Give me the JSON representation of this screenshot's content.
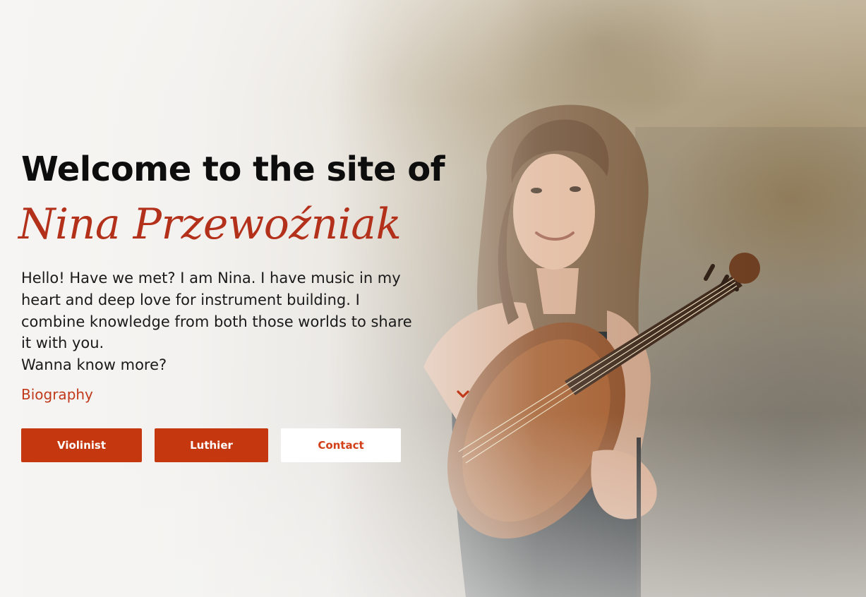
{
  "hero": {
    "welcome": "Welcome to the site of",
    "name": "Nina Przewoźniak",
    "intro_lines": [
      "Hello! Have we met? I am Nina. I have music in my heart and deep love for instrument building. I combine knowledge from both those worlds to share it with you.",
      "Wanna know more?"
    ],
    "accordion": {
      "label": "Biography",
      "icon": "chevron-down-icon"
    },
    "buttons": {
      "violinist": "Violinist",
      "luthier": "Luthier",
      "contact": "Contact"
    }
  },
  "colors": {
    "accent": "#c5370f",
    "name_script": "#b3301b",
    "heading": "#0d0d0d",
    "button_text_light": "#ffffff"
  }
}
